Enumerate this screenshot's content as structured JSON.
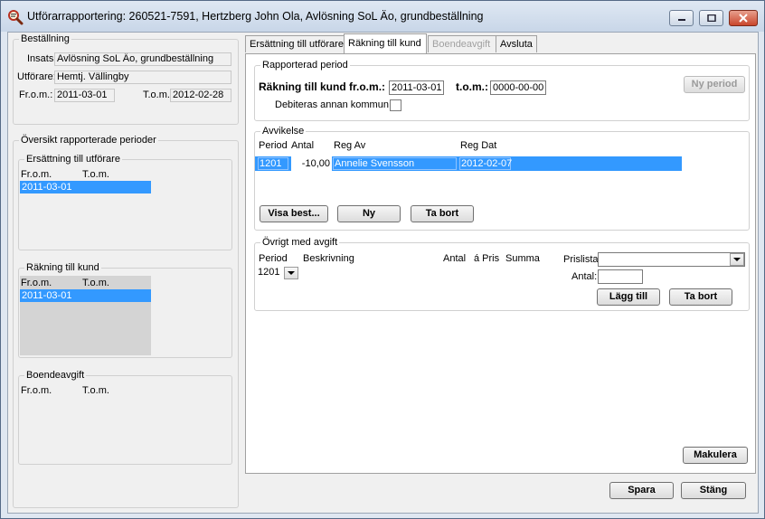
{
  "window": {
    "title": "Utförarrapportering: 260521-7591, Hertzberg  John Ola, Avlösning SoL Äo, grundbeställning"
  },
  "bestallning": {
    "title": "Beställning",
    "insats_label": "Insats:",
    "insats_value": "Avlösning SoL Äo, grundbeställning",
    "utforare_label": "Utförare:",
    "utforare_value": "Hemtj. Vällingby",
    "from_label": "Fr.o.m.:",
    "from_value": "2011-03-01",
    "tom_label": "T.o.m.:",
    "tom_value": "2012-02-28"
  },
  "oversikt": {
    "title": "Översikt rapporterade perioder",
    "ersattning": {
      "title": "Ersättning till utförare",
      "col_from": "Fr.o.m.",
      "col_tom": "T.o.m.",
      "rows": [
        {
          "from": "2011-03-01",
          "tom": ""
        }
      ]
    },
    "rakning": {
      "title": "Räkning till kund",
      "col_from": "Fr.o.m.",
      "col_tom": "T.o.m.",
      "rows": [
        {
          "from": "2011-03-01",
          "tom": ""
        }
      ]
    },
    "boende": {
      "title": "Boendeavgift",
      "col_from": "Fr.o.m.",
      "col_tom": "T.o.m."
    }
  },
  "tabs": [
    {
      "label": "Ersättning till utförare"
    },
    {
      "label": "Räkning till kund"
    },
    {
      "label": "Boendeavgift"
    },
    {
      "label": "Avsluta"
    }
  ],
  "rapporterad": {
    "title": "Rapporterad period",
    "label_prefix": "Räkning till kund ",
    "from_label": "fr.o.m.:",
    "from_value": "2011-03-01",
    "tom_label": "t.o.m.:",
    "tom_value": "0000-00-00",
    "ny_period": "Ny period",
    "debiteras_label": "Debiteras annan kommun:"
  },
  "avvikelse": {
    "title": "Avvikelse",
    "col_period": "Period",
    "col_antal": "Antal",
    "col_regav": "Reg Av",
    "col_regdat": "Reg Dat",
    "row": {
      "period": "1201",
      "antal": "-10,00",
      "regav": "Annelie Svensson",
      "regdat": "2012-02-07"
    },
    "btn_visa": "Visa best...",
    "btn_ny": "Ny",
    "btn_tabort": "Ta bort"
  },
  "ovrigt": {
    "title": "Övrigt med avgift",
    "col_period": "Period",
    "col_beskrivning": "Beskrivning",
    "col_antal": "Antal",
    "col_apris": "á Pris",
    "col_summa": "Summa",
    "period_value": "1201",
    "prislista_label": "Prislista:",
    "prislista_value": "",
    "antal_label": "Antal:",
    "antal_value": "",
    "btn_lagg": "Lägg till",
    "btn_tabort": "Ta bort"
  },
  "footer": {
    "makulera": "Makulera",
    "spara": "Spara",
    "stang": "Stäng"
  }
}
